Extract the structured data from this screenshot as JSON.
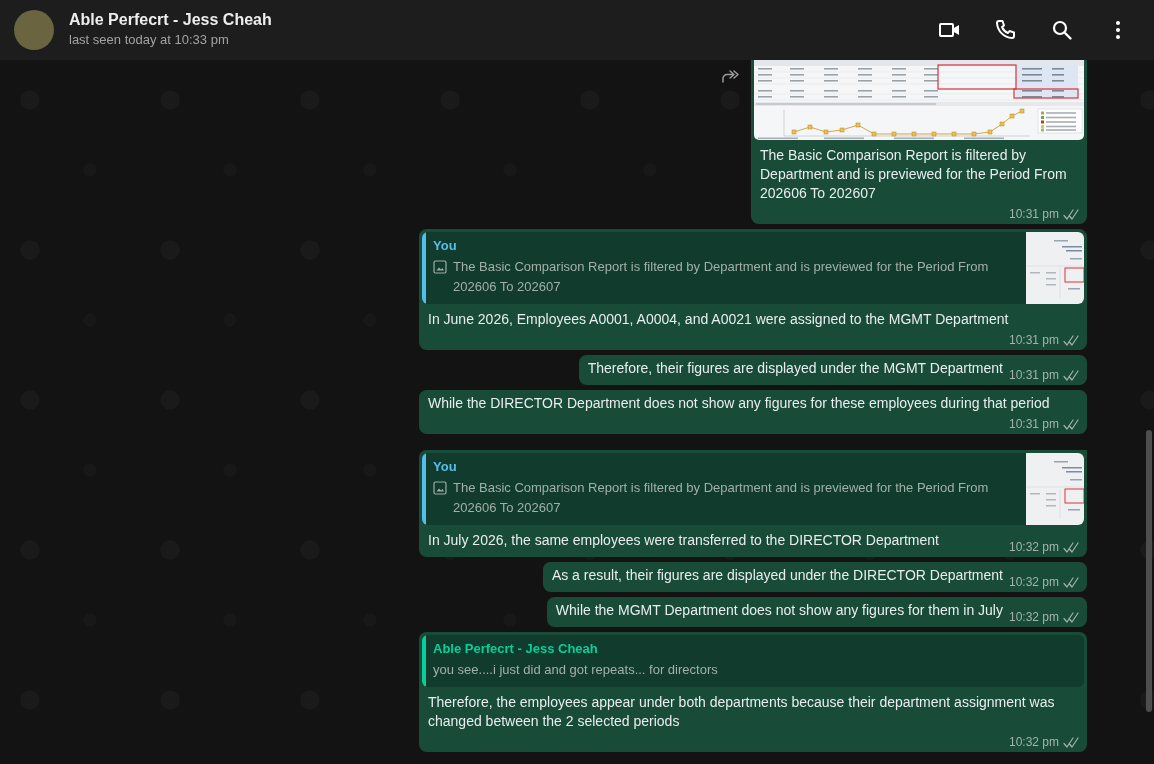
{
  "header": {
    "contact_name": "Able Perfecrt - Jess Cheah",
    "last_seen": "last seen today at 10:33 pm"
  },
  "messages": [
    {
      "kind": "image",
      "caption": "The Basic Comparison Report is filtered by Department and is previewed for the Period From 202606 To 202607",
      "time": "10:31 pm",
      "read": false
    },
    {
      "kind": "reply",
      "quote": {
        "kind": "photo",
        "author": "You",
        "color": "#53bdeb",
        "text": "The Basic Comparison Report is filtered by Department and is previewed for the Period From 202606 To 202607"
      },
      "text": "In June 2026, Employees A0001, A0004, and A0021 were assigned to the MGMT Department",
      "time": "10:31 pm",
      "read": false,
      "group_start": false
    },
    {
      "kind": "text",
      "text": "Therefore, their figures are displayed under the MGMT Department",
      "time": "10:31 pm",
      "read": false,
      "group_start": false
    },
    {
      "kind": "text",
      "text": "While the DIRECTOR Department does not show any figures for these employees during that period",
      "time": "10:31 pm",
      "read": false,
      "group_start": false
    },
    {
      "kind": "reply",
      "quote": {
        "kind": "photo",
        "author": "You",
        "color": "#53bdeb",
        "text": "The Basic Comparison Report is filtered by Department and is previewed for the Period From 202606 To 202607"
      },
      "text": "In July 2026, the same employees were transferred to the DIRECTOR Department",
      "time": "10:32 pm",
      "read": false,
      "group_start": true
    },
    {
      "kind": "text",
      "text": "As a result, their figures are displayed under the DIRECTOR Department",
      "time": "10:32 pm",
      "read": false,
      "group_start": false
    },
    {
      "kind": "text",
      "text": "While the MGMT Department does not show any figures for them in July",
      "time": "10:32 pm",
      "read": false,
      "group_start": false
    },
    {
      "kind": "reply",
      "quote": {
        "kind": "text",
        "author": "Able Perfecrt - Jess Cheah",
        "color": "#06cf9c",
        "text": "you see....i just did and got repeats... for directors"
      },
      "text": "Therefore, the employees appear under both departments because their department assignment was changed between the 2 selected periods",
      "time": "10:32 pm",
      "read": false,
      "group_start": false
    }
  ]
}
